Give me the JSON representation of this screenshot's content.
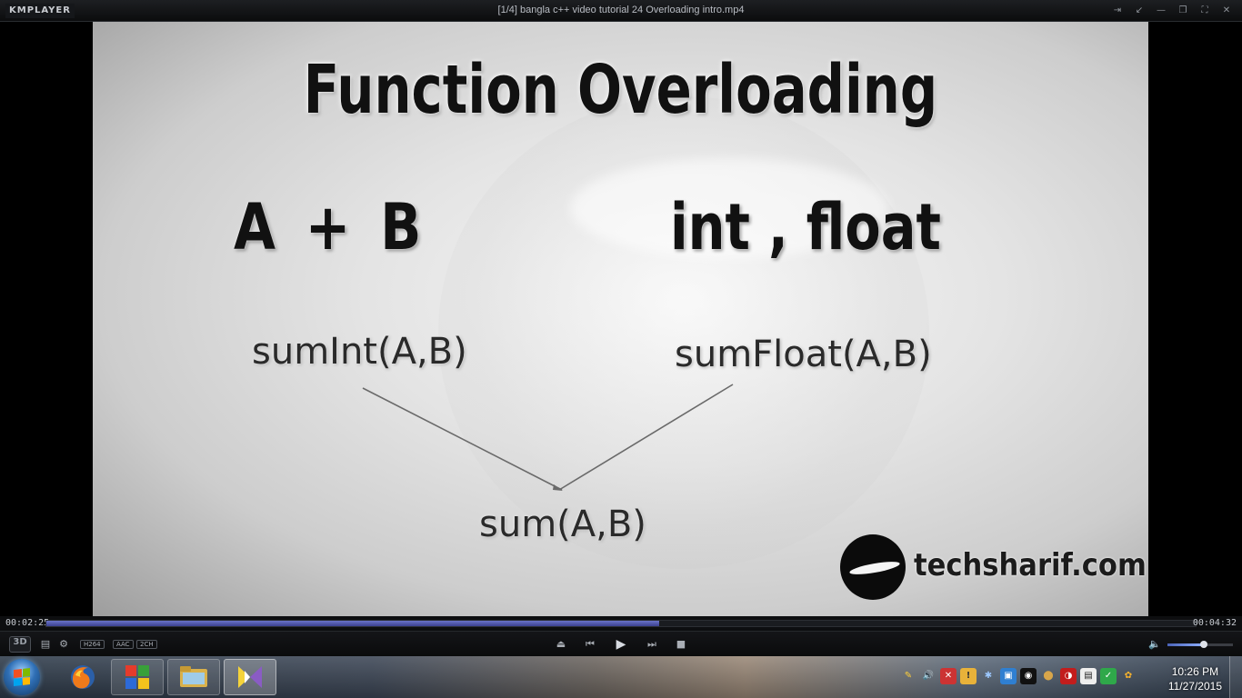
{
  "app": {
    "logo": "KMPLAYER",
    "window_title": "[1/4] bangla c++  video tutorial 24 Overloading intro.mp4"
  },
  "window_buttons": [
    "pin-icon",
    "shrink-icon",
    "minimize-icon",
    "restore-icon",
    "fullscreen-icon",
    "close-icon"
  ],
  "video": {
    "title": "Function Overloading",
    "operands": "A + B",
    "types": "int , float",
    "fn_int": "sumInt(A,B)",
    "fn_float": "sumFloat(A,B)",
    "fn_sum": "sum(A,B)",
    "brand": "techsharif.com"
  },
  "playback": {
    "current_time": "00:02:25",
    "total_time": "00:04:32",
    "progress": 0.533
  },
  "controls": {
    "btn_3d": "3D",
    "codecs": [
      "H264",
      "AAC",
      "2CH"
    ],
    "volume": 0.55
  },
  "taskbar": {
    "items": [
      "firefox-icon",
      "windows-media-icon",
      "file-explorer-icon",
      "kmplayer-icon"
    ],
    "tray_icons": [
      "pen-icon",
      "volume-icon",
      "network-icon",
      "flag-icon",
      "bluetooth-icon",
      "app-icon",
      "camera-icon",
      "idm-icon",
      "lock-icon",
      "check-icon",
      "sound-icon"
    ],
    "clock_time": "10:26 PM",
    "clock_date": "11/27/2015"
  },
  "colors": {
    "progress": "#4b52a8",
    "accent": "#8fb1ff"
  }
}
